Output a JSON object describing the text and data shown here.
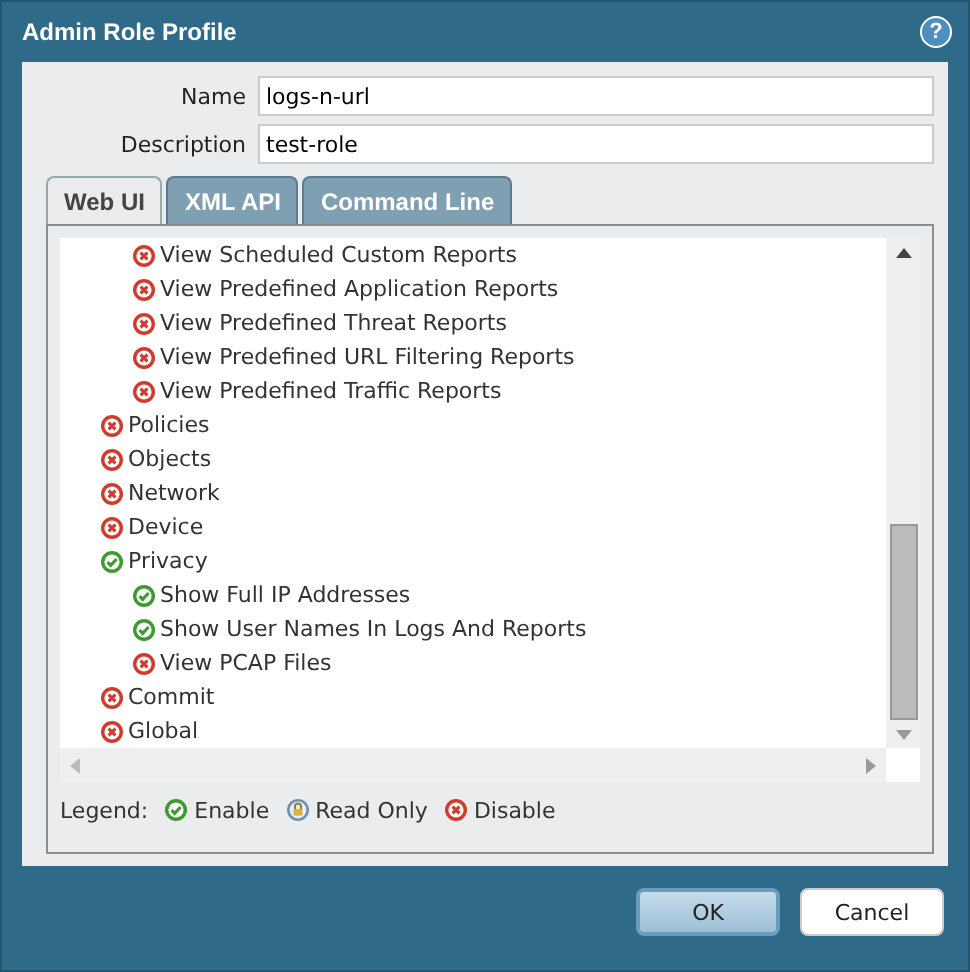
{
  "window": {
    "title": "Admin Role Profile",
    "help": "?"
  },
  "fields": [
    {
      "label": "Name",
      "value": "logs-n-url"
    },
    {
      "label": "Description",
      "value": "test-role"
    }
  ],
  "tabs": [
    {
      "label": "Web UI",
      "selected": true
    },
    {
      "label": "XML API",
      "selected": false
    },
    {
      "label": "Command Line",
      "selected": false
    }
  ],
  "tree": [
    {
      "children": [
        {
          "label": "View Scheduled Custom Reports",
          "kind": "disable"
        },
        {
          "label": "View Predefined Application Reports",
          "kind": "disable"
        },
        {
          "label": "View Predefined Threat Reports",
          "kind": "disable"
        },
        {
          "label": "View Predefined URL Filtering Reports",
          "kind": "disable"
        },
        {
          "label": "View Predefined Traffic Reports",
          "kind": "disable"
        }
      ]
    },
    {
      "label": "Policies",
      "kind": "disable"
    },
    {
      "label": "Objects",
      "kind": "disable"
    },
    {
      "label": "Network",
      "kind": "disable"
    },
    {
      "label": "Device",
      "kind": "disable"
    },
    {
      "label": "Privacy",
      "kind": "enable",
      "children": [
        {
          "label": "Show Full IP Addresses",
          "kind": "enable"
        },
        {
          "label": "Show User Names In Logs And Reports",
          "kind": "enable"
        },
        {
          "label": "View PCAP Files",
          "kind": "disable"
        }
      ]
    },
    {
      "label": "Commit",
      "kind": "disable"
    },
    {
      "label": "Global",
      "kind": "disable"
    }
  ],
  "legend": {
    "label": "Legend:",
    "items": [
      {
        "label": "Enable",
        "kind": "enable"
      },
      {
        "label": "Read Only",
        "kind": "readonly"
      },
      {
        "label": "Disable",
        "kind": "disable"
      }
    ]
  },
  "buttons": [
    {
      "label": "OK",
      "default": true
    },
    {
      "label": "Cancel",
      "default": false
    }
  ]
}
